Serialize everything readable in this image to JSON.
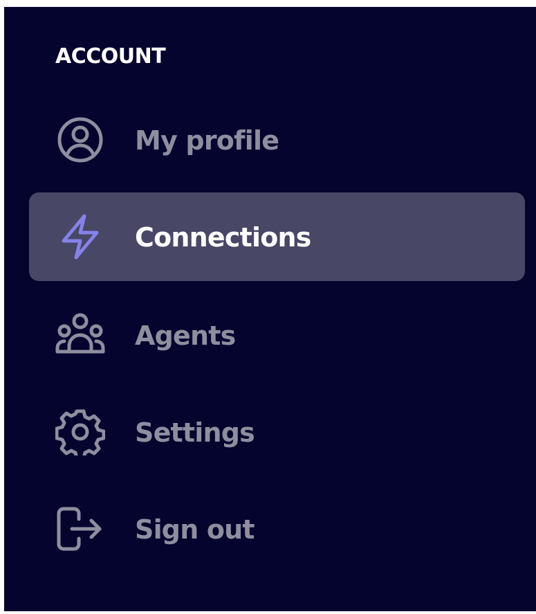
{
  "sidebar": {
    "section_title": "ACCOUNT",
    "items": [
      {
        "label": "My profile",
        "icon": "user-circle-icon",
        "active": false
      },
      {
        "label": "Connections",
        "icon": "lightning-bolt-icon",
        "active": true
      },
      {
        "label": "Agents",
        "icon": "user-group-icon",
        "active": false
      },
      {
        "label": "Settings",
        "icon": "gear-icon",
        "active": false
      },
      {
        "label": "Sign out",
        "icon": "sign-out-icon",
        "active": false
      }
    ]
  },
  "colors": {
    "background": "#05042e",
    "active_background": "#484766",
    "muted_text": "#8e8e9f",
    "active_text": "#ffffff",
    "active_icon": "#8582ea"
  }
}
